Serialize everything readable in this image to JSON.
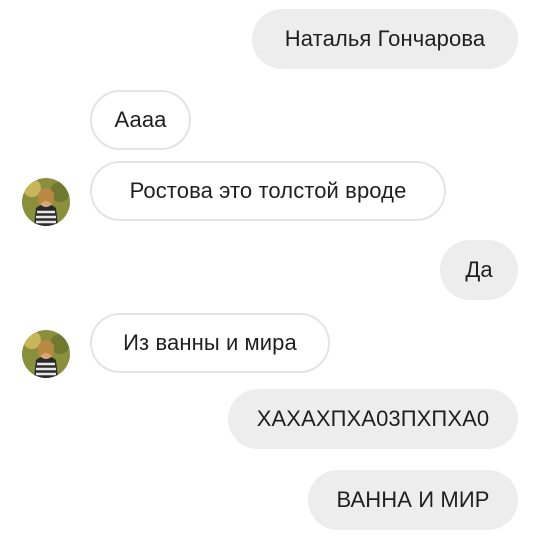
{
  "messages": [
    {
      "side": "out",
      "text": "Наталья Гончарова"
    },
    {
      "side": "in",
      "text": "Аааа",
      "avatar": false
    },
    {
      "side": "in",
      "text": "Ростова это толстой вроде",
      "avatar": true
    },
    {
      "side": "out",
      "text": "Да"
    },
    {
      "side": "in",
      "text": "Из ванны и мира",
      "avatar": true
    },
    {
      "side": "out",
      "text": "ХАХАХПХА03ПХПХА0"
    },
    {
      "side": "out",
      "text": "ВАННА И МИР"
    }
  ],
  "colors": {
    "outgoing_bubble": "#ededed",
    "incoming_border": "#e4e4e4",
    "text": "#1f1f1f"
  },
  "icons": {
    "avatar": "contact-photo-avatar"
  }
}
